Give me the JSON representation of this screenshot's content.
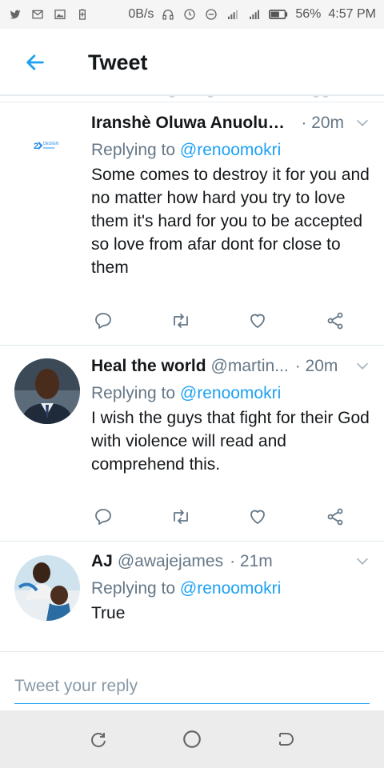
{
  "status_bar": {
    "network_speed": "0B/s",
    "battery": "56%",
    "time": "4:57 PM"
  },
  "header": {
    "title": "Tweet"
  },
  "tweets": [
    {
      "name": "Iranshè Oluwa Anuoluw...",
      "handle": "",
      "time": "· 20m",
      "reply_prefix": "Replying to ",
      "reply_to": "@renoomokri",
      "text": "Some comes to destroy it for you and no matter how hard you try to love them it's hard for you to be accepted so love from afar dont for close to them",
      "avatar_text": "DESIGN"
    },
    {
      "name": "Heal the world",
      "handle": "@martin...",
      "time": "· 20m",
      "reply_prefix": "Replying to ",
      "reply_to": "@renoomokri",
      "text": "I wish the guys that fight for their God with violence will read and comprehend this."
    },
    {
      "name": "AJ",
      "handle": "@awajejames",
      "time": "· 21m",
      "reply_prefix": "Replying to ",
      "reply_to": "@renoomokri",
      "text": "True"
    }
  ],
  "reply_box": {
    "placeholder": "Tweet your reply"
  },
  "colors": {
    "accent": "#1da1f2",
    "secondary_text": "#657786"
  }
}
